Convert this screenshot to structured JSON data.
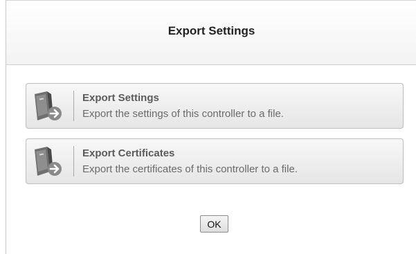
{
  "dialog": {
    "title": "Export Settings"
  },
  "options": [
    {
      "title": "Export Settings",
      "description": "Export the settings of this controller to a file.",
      "icon": "controller-export-icon"
    },
    {
      "title": "Export Certificates",
      "description": "Export the certificates of this controller to a file.",
      "icon": "controller-export-icon"
    }
  ],
  "buttons": {
    "ok_label": "OK"
  },
  "colors": {
    "header_bg": "#f3f3f3",
    "option_bg": "#e6e6e6",
    "option_title": "#5b5b5b",
    "arrow_badge": "#8a8a8a"
  }
}
